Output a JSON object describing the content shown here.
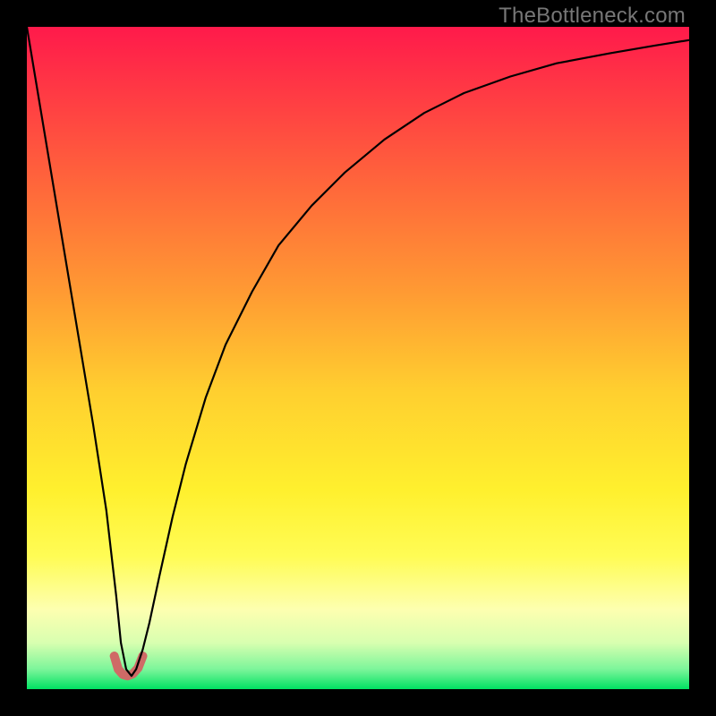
{
  "watermark": "TheBottleneck.com",
  "chart_data": {
    "type": "line",
    "title": "",
    "xlabel": "",
    "ylabel": "",
    "xlim": [
      0,
      100
    ],
    "ylim": [
      0,
      100
    ],
    "grid": false,
    "legend": false,
    "background_gradient": {
      "stops": [
        {
          "offset": 0.0,
          "color": "#ff1a4b"
        },
        {
          "offset": 0.1,
          "color": "#ff3a44"
        },
        {
          "offset": 0.25,
          "color": "#ff6a3a"
        },
        {
          "offset": 0.4,
          "color": "#ff9a33"
        },
        {
          "offset": 0.55,
          "color": "#ffcf2f"
        },
        {
          "offset": 0.7,
          "color": "#fff02e"
        },
        {
          "offset": 0.8,
          "color": "#fffc55"
        },
        {
          "offset": 0.88,
          "color": "#fdffb0"
        },
        {
          "offset": 0.93,
          "color": "#d8ffb0"
        },
        {
          "offset": 0.97,
          "color": "#7cf59a"
        },
        {
          "offset": 1.0,
          "color": "#00e262"
        }
      ]
    },
    "series": [
      {
        "name": "bottleneck-curve",
        "color": "#000000",
        "width": 2.2,
        "x": [
          0,
          2,
          4,
          6,
          8,
          10,
          12,
          13.5,
          14.2,
          15,
          15.8,
          16.5,
          17.5,
          18.5,
          20,
          22,
          24,
          27,
          30,
          34,
          38,
          43,
          48,
          54,
          60,
          66,
          73,
          80,
          88,
          95,
          100
        ],
        "y": [
          100,
          88,
          76,
          64,
          52,
          40,
          27,
          14,
          7,
          3,
          2,
          3,
          6,
          10,
          17,
          26,
          34,
          44,
          52,
          60,
          67,
          73,
          78,
          83,
          87,
          90,
          92.5,
          94.5,
          96,
          97.2,
          98
        ]
      }
    ],
    "valley_marker": {
      "color": "#cf6a66",
      "width": 10,
      "x": [
        13.2,
        13.8,
        14.5,
        15.2,
        16.0,
        16.8,
        17.5
      ],
      "y": [
        5.0,
        3.0,
        2.2,
        2.0,
        2.3,
        3.2,
        5.0
      ]
    }
  }
}
